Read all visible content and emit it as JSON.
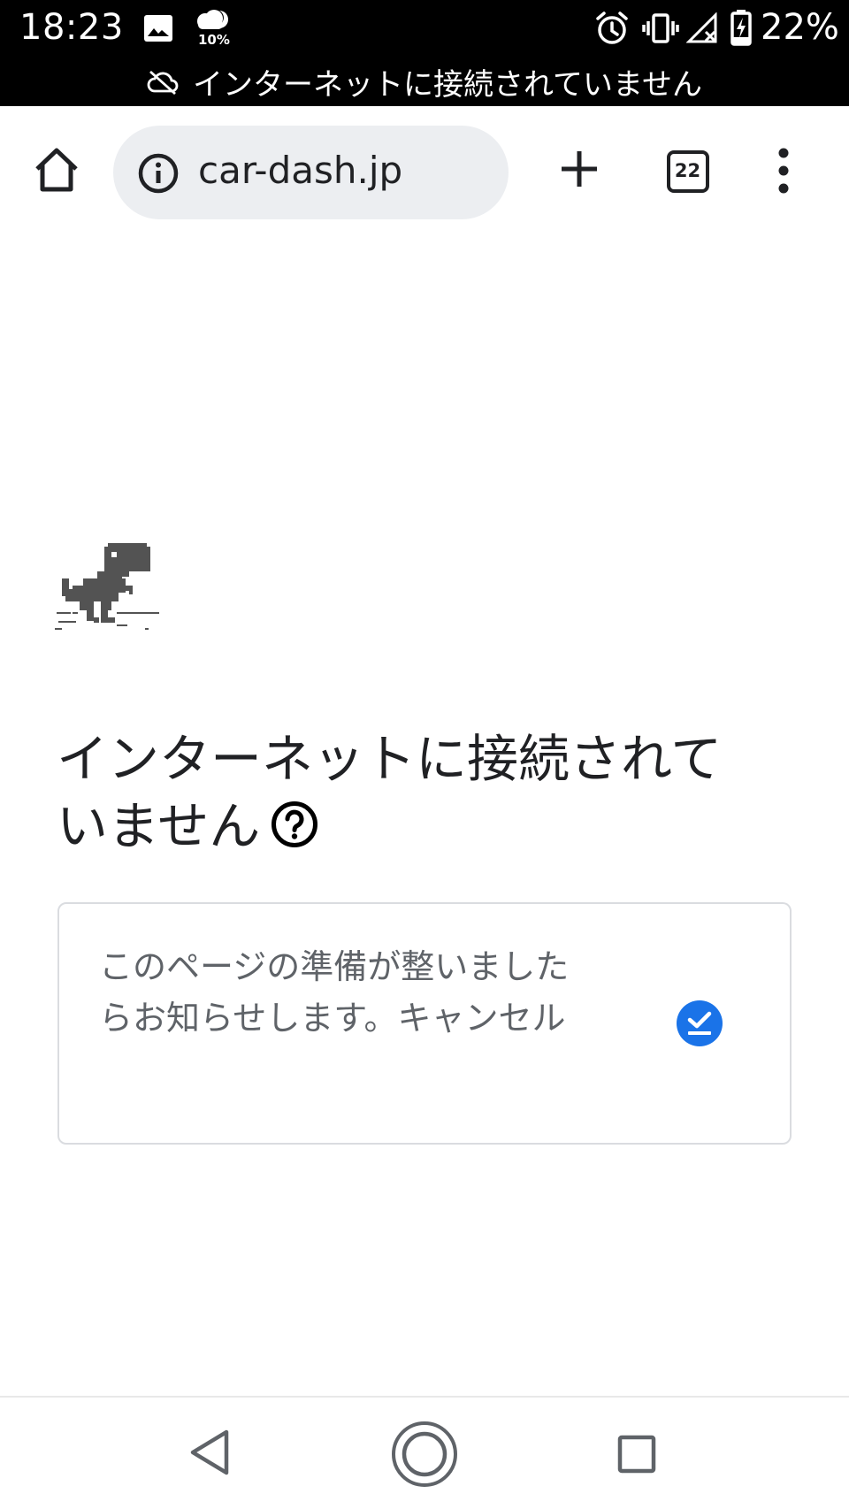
{
  "status_bar": {
    "time": "18:23",
    "weather_percent": "10%",
    "battery_percent": "22%",
    "offline_banner": "インターネットに接続されていません"
  },
  "toolbar": {
    "url": "car-dash.jp",
    "tab_count": "22"
  },
  "error_page": {
    "heading": "インターネットに接続されていません",
    "notify_card_text": "このページの準備が整いましたらお知らせします。キャンセル"
  },
  "colors": {
    "status_bar_bg": "#000000",
    "url_bar_bg": "#eceef1",
    "check_blue": "#1a73e8",
    "dino_gray": "#535353"
  },
  "icons": {
    "home": "home-icon",
    "info": "info-icon",
    "new_tab": "plus-icon",
    "tabs": "tab-switcher-icon",
    "menu": "more-vert-icon",
    "help": "help-circle-icon",
    "notify": "check-circle-icon",
    "nav_back": "back-triangle-icon",
    "nav_home": "home-circle-icon",
    "nav_recent": "recents-square-icon"
  }
}
